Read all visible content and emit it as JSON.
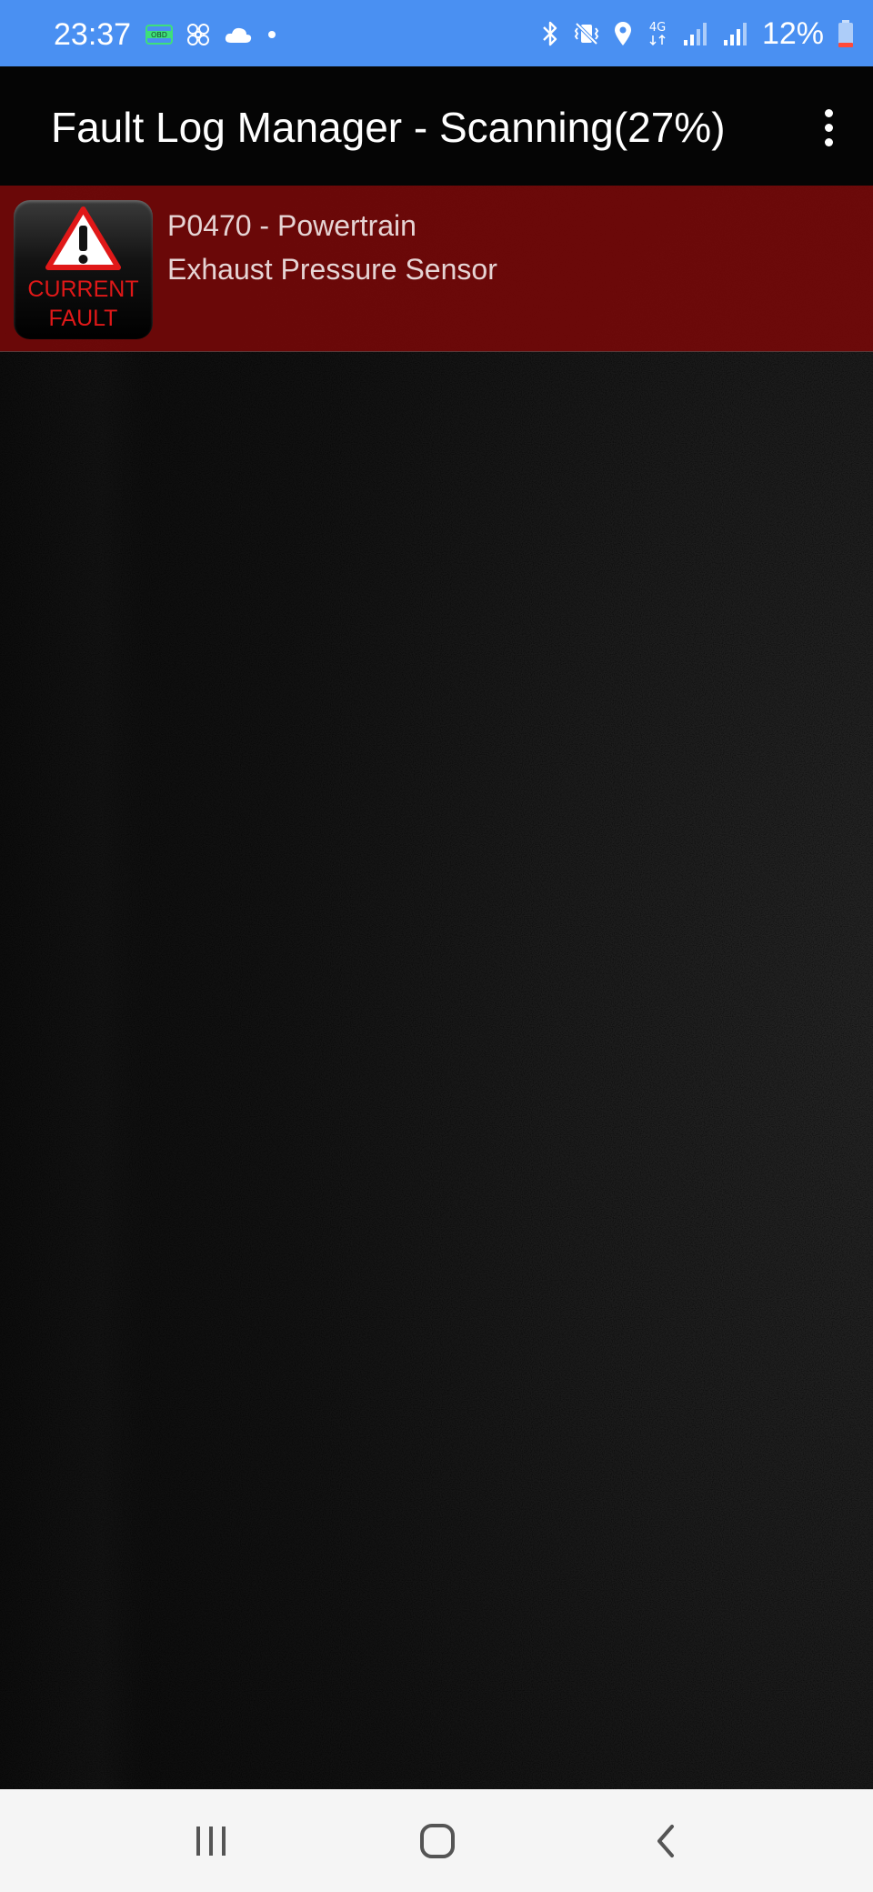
{
  "status_bar": {
    "time": "23:37",
    "battery_percent": "12%",
    "network_label": "4G",
    "obd_label": "OBD",
    "left_icons": [
      "obd-icon",
      "fan-icon",
      "cloud-icon",
      "dot-icon"
    ],
    "right_icons": [
      "bluetooth-icon",
      "vibrate-mute-icon",
      "location-icon",
      "4g-icon",
      "signal-icon",
      "signal-icon",
      "battery-icon"
    ],
    "background_color": "#4a90f2"
  },
  "app_bar": {
    "title": "Fault Log Manager - Scanning(27%)",
    "menu_icon": "more-vert-icon"
  },
  "faults": [
    {
      "badge_line1": "CURRENT",
      "badge_line2": "FAULT",
      "badge_icon": "warning-triangle-icon",
      "title": "P0470 - Powertrain",
      "description": "Exhaust Pressure Sensor",
      "row_color": "#780808"
    }
  ],
  "nav_bar": {
    "buttons": [
      "recent-apps-icon",
      "home-icon",
      "back-icon"
    ]
  }
}
